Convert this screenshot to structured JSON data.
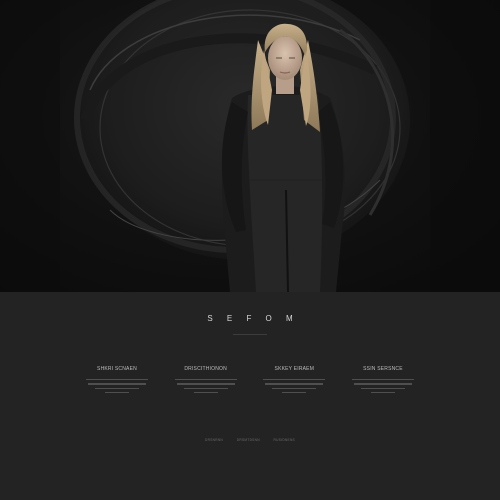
{
  "brand": {
    "name": "S E F O M"
  },
  "features": [
    {
      "title": "SHKRI SCNAEN"
    },
    {
      "title": "DRISCITHIONON"
    },
    {
      "title": "SKKEY EIRAEM"
    },
    {
      "title": "SSIN SERSNCE"
    }
  ],
  "footer": {
    "links": [
      {
        "label": "DRSNRNN"
      },
      {
        "label": "DRSMTDSNN"
      },
      {
        "label": "RUSIDNENS"
      }
    ]
  },
  "colors": {
    "hero_background": "#0e0e0e",
    "section_background": "#232323",
    "text_primary": "#d8d8d8",
    "text_muted": "#6c6c6c"
  }
}
